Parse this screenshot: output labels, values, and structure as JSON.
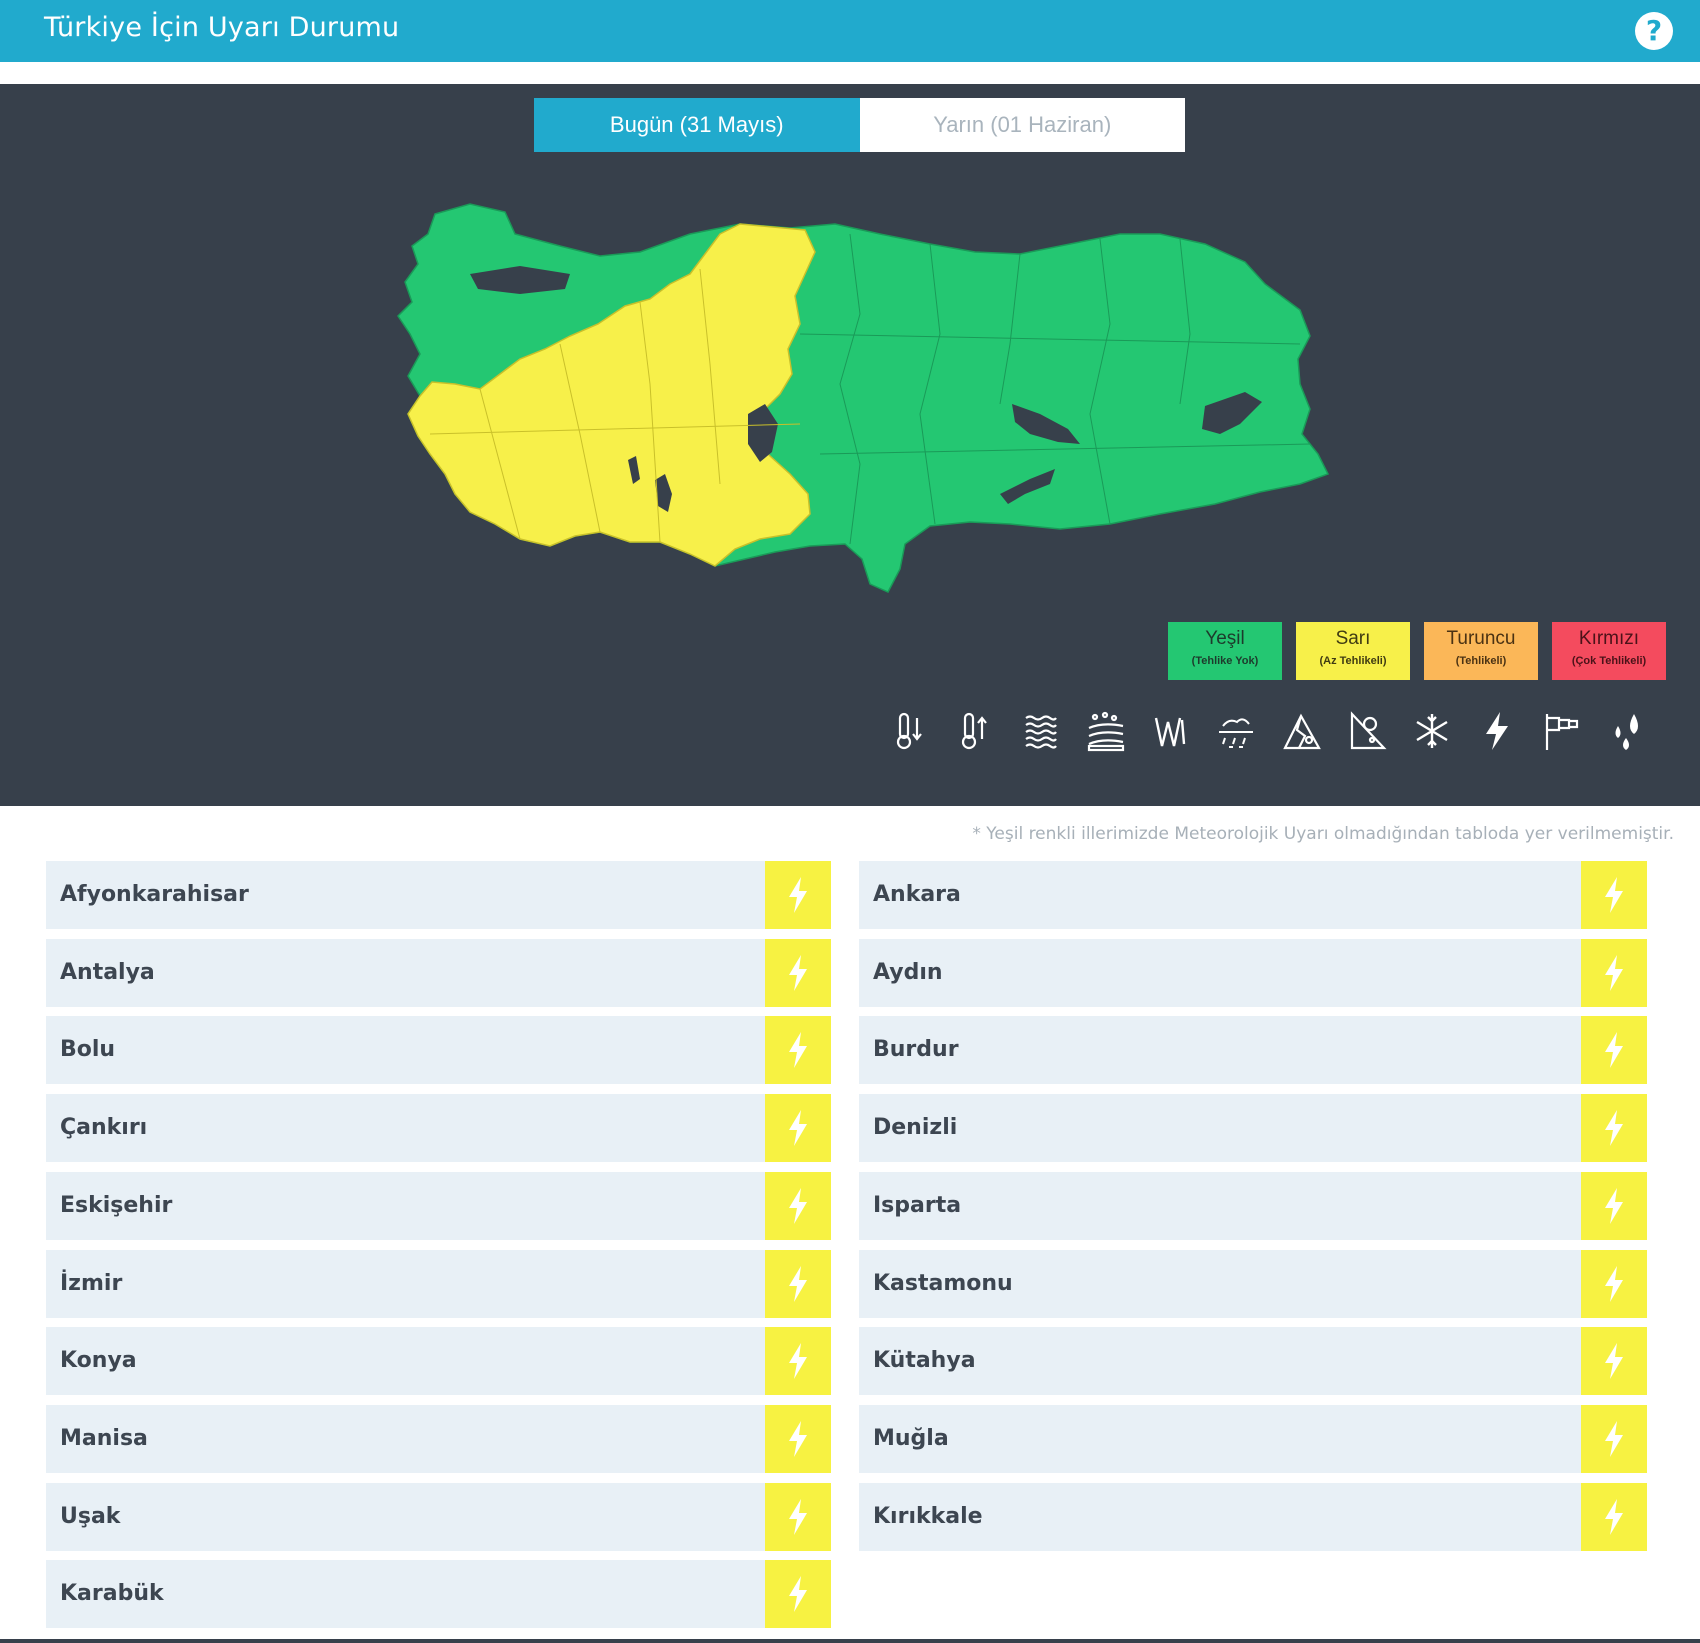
{
  "header": {
    "title": "Türkiye İçin Uyarı Durumu",
    "help_icon": "help-icon"
  },
  "tabs": [
    {
      "label": "Bugün (31 Mayıs)",
      "active": true
    },
    {
      "label": "Yarın (01 Haziran)",
      "active": false
    }
  ],
  "map": {
    "region_colors": {
      "no_warning": "#24c772",
      "minor": "#f7f04a",
      "background": "#37404b"
    }
  },
  "legend": [
    {
      "label": "Yeşil",
      "sub": "(Tehlike Yok)",
      "color": "#24c772"
    },
    {
      "label": "Sarı",
      "sub": "(Az Tehlikeli)",
      "color": "#f7f04a"
    },
    {
      "label": "Turuncu",
      "sub": "(Tehlikeli)",
      "color": "#fbb758"
    },
    {
      "label": "Kırmızı",
      "sub": "(Çok Tehlikeli)",
      "color": "#f44b5e"
    }
  ],
  "hazard_icons": [
    "cold-temperature-icon",
    "hot-temperature-icon",
    "fog-icon",
    "dust-icon",
    "wind-icon",
    "snow-rain-icon",
    "avalanche-icon",
    "landslide-icon",
    "snow-icon",
    "thunderstorm-icon",
    "strong-wind-icon",
    "rain-icon"
  ],
  "note": "* Yeşil renkli illerimizde Meteorolojik Uyarı olmadığından tabloda yer verilmemiştir.",
  "warning_color": "#f7f242",
  "provinces_left": [
    "Afyonkarahisar",
    "Antalya",
    "Bolu",
    "Çankırı",
    "Eskişehir",
    "İzmir",
    "Konya",
    "Manisa",
    "Uşak",
    "Karabük"
  ],
  "provinces_right": [
    "Ankara",
    "Aydın",
    "Burdur",
    "Denizli",
    "Isparta",
    "Kastamonu",
    "Kütahya",
    "Muğla",
    "Kırıkkale"
  ]
}
